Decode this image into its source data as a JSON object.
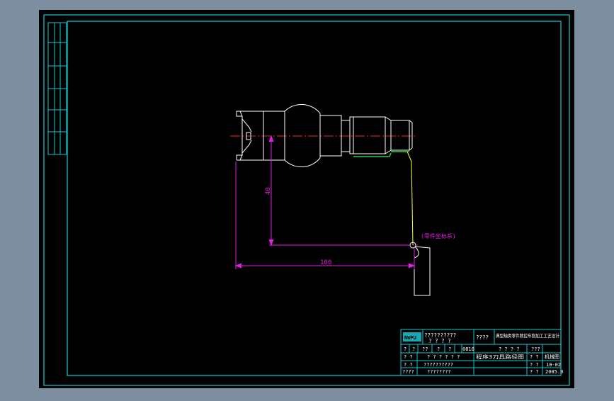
{
  "colors": {
    "bg": "#7e8ea1",
    "sheet": "#000000",
    "frame": "#18c8d2",
    "part": "#ffffff",
    "dim": "#e020e0",
    "center": "#ff2020",
    "path": "#ffff30",
    "thread": "#30d040",
    "title": "#ffffff"
  },
  "drawing": {
    "dim_horizontal": "100",
    "dim_vertical": "40",
    "note": "(零件坐标系)"
  },
  "title_block": {
    "logo": "NWPU",
    "r0c1": "??????????",
    "r0c1b": "? ? ? ?",
    "r0c2": "????",
    "r0c3": "典型轴类零件数控车削加工工艺设计",
    "r1": [
      "?",
      "?",
      "??",
      "?",
      "?",
      "0810"
    ],
    "r1c3": "? ? ? ?",
    "r1c4": "???",
    "r2a": "? ?",
    "r2b": "? ? ? ? ? ?",
    "r2c3": "程序3刀具路径图",
    "r2c4a": "? ?",
    "r2c4b": "机械图",
    "r3a": "? ?",
    "r3b": "??????????",
    "r3c4a": "? ?",
    "r3c4b": "10-02",
    "r4a": "????",
    "r4b": "????????",
    "r4c4a": "? ?",
    "r4c4b": "2005.9"
  }
}
